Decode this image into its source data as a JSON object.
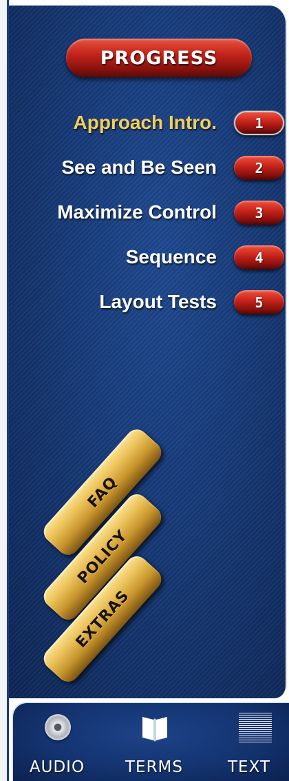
{
  "header": {
    "title": "PROGRESS"
  },
  "menu": {
    "items": [
      {
        "label": "Approach Intro.",
        "badge": "1",
        "active": true
      },
      {
        "label": "See and Be Seen",
        "badge": "2",
        "active": false
      },
      {
        "label": "Maximize Control",
        "badge": "3",
        "active": false
      },
      {
        "label": "Sequence",
        "badge": "4",
        "active": false
      },
      {
        "label": "Layout Tests",
        "badge": "5",
        "active": false
      }
    ]
  },
  "side_buttons": {
    "faq": "FAQ",
    "policy": "POLICY",
    "extras": "EXTRAS"
  },
  "toolbar": {
    "audio": {
      "label": "AUDIO",
      "icon": "audio-disc-icon"
    },
    "terms": {
      "label": "TERMS",
      "icon": "book-icon"
    },
    "text": {
      "label": "TEXT",
      "icon": "text-page-icon"
    }
  },
  "colors": {
    "panel": "#173a78",
    "active_label": "#f3cf59",
    "badge_red": "#c4241a",
    "gold": "#e0b04a"
  }
}
